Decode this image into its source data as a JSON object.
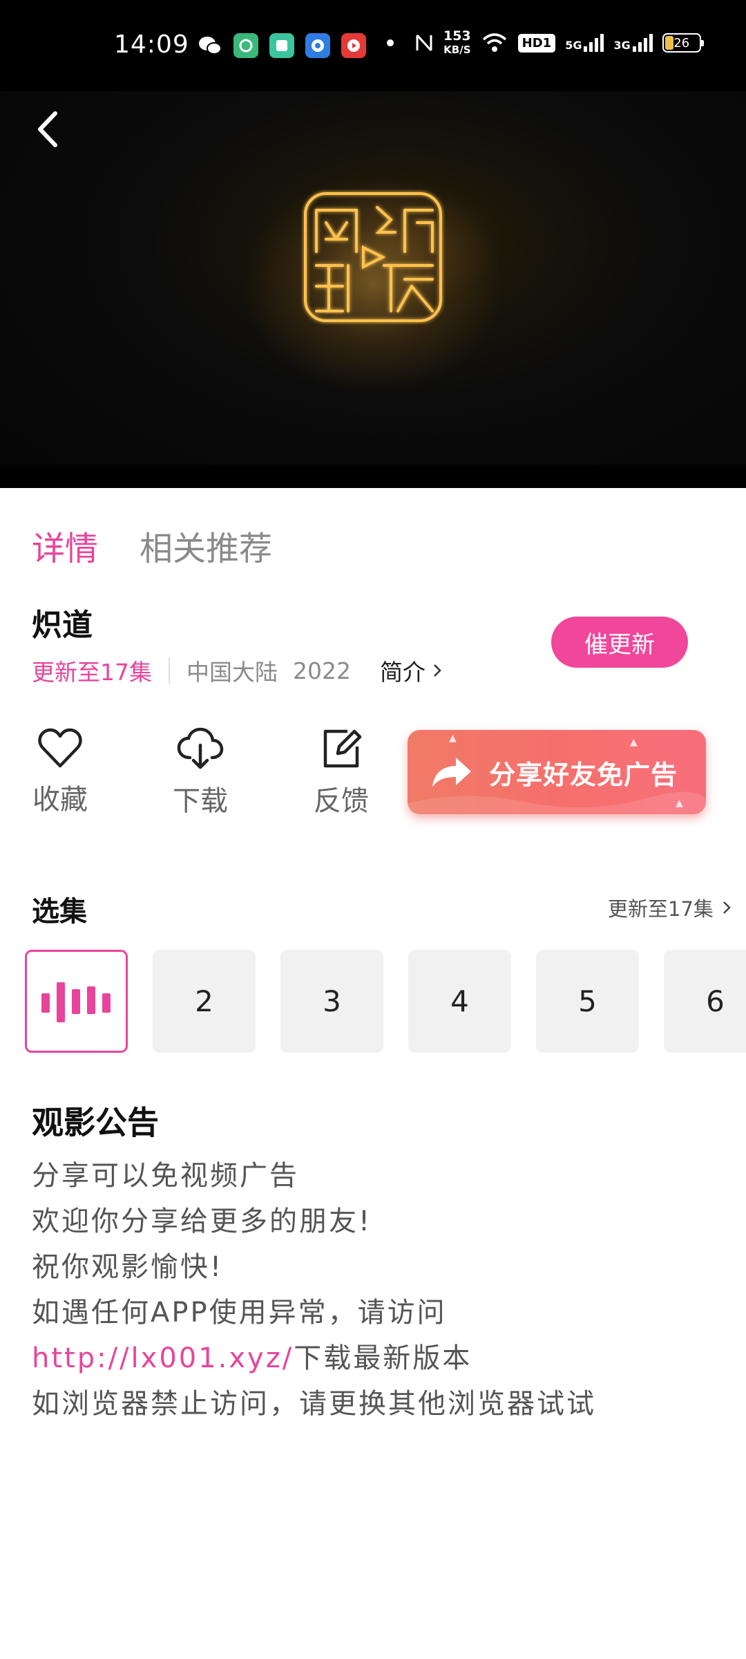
{
  "status_bar": {
    "time": "14:09",
    "apps": [
      {
        "icon": "wechat-icon",
        "color": "#000000"
      },
      {
        "icon": "app-green-icon",
        "color": "#3ab87a"
      },
      {
        "icon": "app-teal-icon",
        "color": "#3cc4a0"
      },
      {
        "icon": "app-blue-icon",
        "color": "#2f7de1"
      },
      {
        "icon": "app-red-icon",
        "color": "#e53935"
      }
    ],
    "speed_value": "153",
    "speed_unit": "KB/S",
    "hd": "HD1",
    "net1": "5G",
    "net2": "3G",
    "battery": "26"
  },
  "player": {
    "logo_text": "网络视听"
  },
  "tabs": [
    {
      "label": "详情",
      "active": true
    },
    {
      "label": "相关推荐",
      "active": false
    }
  ],
  "show": {
    "title": "炽道",
    "update_status": "更新至17集",
    "region": "中国大陆",
    "year": "2022",
    "intro_label": "简介",
    "remind_button": "催更新"
  },
  "actions": {
    "favorite": "收藏",
    "download": "下载",
    "feedback": "反馈",
    "share_banner": "分享好友免广告"
  },
  "episodes": {
    "section_title": "选集",
    "more_label": "更新至17集",
    "items": [
      "2",
      "3",
      "4",
      "5",
      "6"
    ],
    "current_index": 0
  },
  "notice": {
    "title": "观影公告",
    "lines": [
      "分享可以免视频广告",
      "欢迎你分享给更多的朋友!",
      "祝你观影愉快!",
      "如遇任何APP使用异常，请访问"
    ],
    "link": "http://lx001.xyz/",
    "link_suffix": "下载最新版本",
    "last_line": "如浏览器禁止访问，请更换其他浏览器试试"
  },
  "colors": {
    "accent": "#e8449b",
    "button": "#f1479a",
    "share_banner": "#f5706c"
  }
}
